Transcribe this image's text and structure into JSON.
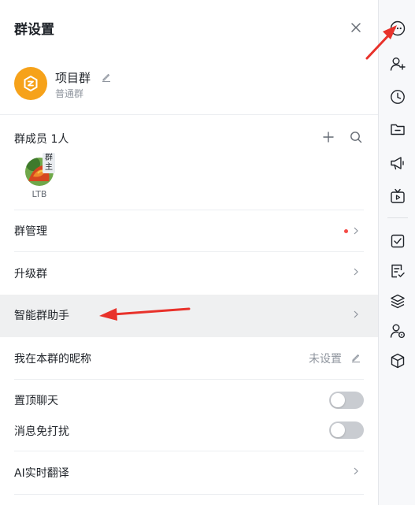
{
  "header": {
    "title": "群设置"
  },
  "group": {
    "name": "项目群",
    "type": "普通群",
    "accent": "#f6a21a"
  },
  "members": {
    "label": "群成员 1人",
    "list": [
      {
        "name": "LTB",
        "badge": "群主"
      }
    ]
  },
  "rows": {
    "manage": "群管理",
    "upgrade": "升级群",
    "assistant": "智能群助手",
    "nickname": "我在本群的昵称",
    "nickname_value": "未设置",
    "pin": "置顶聊天",
    "mute": "消息免打扰",
    "translate": "AI实时翻译"
  },
  "toggles": {
    "pin": false,
    "mute": false
  },
  "colors": {
    "annotation_arrow": "#e8322b",
    "notify_dot": "#f54a45",
    "row_highlight": "#eff0f1"
  },
  "rail_icons": [
    "more-chat-icon",
    "add-member-icon",
    "history-icon",
    "folder-icon",
    "announcement-icon",
    "live-tv-icon",
    "task-icon",
    "checklist-icon",
    "layers-icon",
    "member-settings-icon",
    "package-icon"
  ]
}
